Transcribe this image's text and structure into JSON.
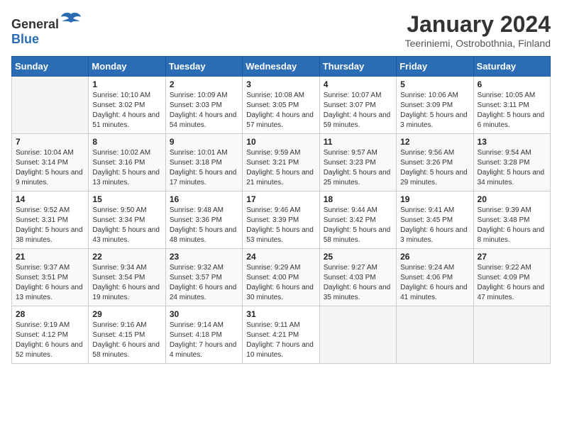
{
  "logo": {
    "general": "General",
    "blue": "Blue"
  },
  "header": {
    "title": "January 2024",
    "subtitle": "Teeriniemi, Ostrobothnia, Finland"
  },
  "weekdays": [
    "Sunday",
    "Monday",
    "Tuesday",
    "Wednesday",
    "Thursday",
    "Friday",
    "Saturday"
  ],
  "weeks": [
    [
      {
        "day": "",
        "sunrise": "",
        "sunset": "",
        "daylight": ""
      },
      {
        "day": "1",
        "sunrise": "Sunrise: 10:10 AM",
        "sunset": "Sunset: 3:02 PM",
        "daylight": "Daylight: 4 hours and 51 minutes."
      },
      {
        "day": "2",
        "sunrise": "Sunrise: 10:09 AM",
        "sunset": "Sunset: 3:03 PM",
        "daylight": "Daylight: 4 hours and 54 minutes."
      },
      {
        "day": "3",
        "sunrise": "Sunrise: 10:08 AM",
        "sunset": "Sunset: 3:05 PM",
        "daylight": "Daylight: 4 hours and 57 minutes."
      },
      {
        "day": "4",
        "sunrise": "Sunrise: 10:07 AM",
        "sunset": "Sunset: 3:07 PM",
        "daylight": "Daylight: 4 hours and 59 minutes."
      },
      {
        "day": "5",
        "sunrise": "Sunrise: 10:06 AM",
        "sunset": "Sunset: 3:09 PM",
        "daylight": "Daylight: 5 hours and 3 minutes."
      },
      {
        "day": "6",
        "sunrise": "Sunrise: 10:05 AM",
        "sunset": "Sunset: 3:11 PM",
        "daylight": "Daylight: 5 hours and 6 minutes."
      }
    ],
    [
      {
        "day": "7",
        "sunrise": "Sunrise: 10:04 AM",
        "sunset": "Sunset: 3:14 PM",
        "daylight": "Daylight: 5 hours and 9 minutes."
      },
      {
        "day": "8",
        "sunrise": "Sunrise: 10:02 AM",
        "sunset": "Sunset: 3:16 PM",
        "daylight": "Daylight: 5 hours and 13 minutes."
      },
      {
        "day": "9",
        "sunrise": "Sunrise: 10:01 AM",
        "sunset": "Sunset: 3:18 PM",
        "daylight": "Daylight: 5 hours and 17 minutes."
      },
      {
        "day": "10",
        "sunrise": "Sunrise: 9:59 AM",
        "sunset": "Sunset: 3:21 PM",
        "daylight": "Daylight: 5 hours and 21 minutes."
      },
      {
        "day": "11",
        "sunrise": "Sunrise: 9:57 AM",
        "sunset": "Sunset: 3:23 PM",
        "daylight": "Daylight: 5 hours and 25 minutes."
      },
      {
        "day": "12",
        "sunrise": "Sunrise: 9:56 AM",
        "sunset": "Sunset: 3:26 PM",
        "daylight": "Daylight: 5 hours and 29 minutes."
      },
      {
        "day": "13",
        "sunrise": "Sunrise: 9:54 AM",
        "sunset": "Sunset: 3:28 PM",
        "daylight": "Daylight: 5 hours and 34 minutes."
      }
    ],
    [
      {
        "day": "14",
        "sunrise": "Sunrise: 9:52 AM",
        "sunset": "Sunset: 3:31 PM",
        "daylight": "Daylight: 5 hours and 38 minutes."
      },
      {
        "day": "15",
        "sunrise": "Sunrise: 9:50 AM",
        "sunset": "Sunset: 3:34 PM",
        "daylight": "Daylight: 5 hours and 43 minutes."
      },
      {
        "day": "16",
        "sunrise": "Sunrise: 9:48 AM",
        "sunset": "Sunset: 3:36 PM",
        "daylight": "Daylight: 5 hours and 48 minutes."
      },
      {
        "day": "17",
        "sunrise": "Sunrise: 9:46 AM",
        "sunset": "Sunset: 3:39 PM",
        "daylight": "Daylight: 5 hours and 53 minutes."
      },
      {
        "day": "18",
        "sunrise": "Sunrise: 9:44 AM",
        "sunset": "Sunset: 3:42 PM",
        "daylight": "Daylight: 5 hours and 58 minutes."
      },
      {
        "day": "19",
        "sunrise": "Sunrise: 9:41 AM",
        "sunset": "Sunset: 3:45 PM",
        "daylight": "Daylight: 6 hours and 3 minutes."
      },
      {
        "day": "20",
        "sunrise": "Sunrise: 9:39 AM",
        "sunset": "Sunset: 3:48 PM",
        "daylight": "Daylight: 6 hours and 8 minutes."
      }
    ],
    [
      {
        "day": "21",
        "sunrise": "Sunrise: 9:37 AM",
        "sunset": "Sunset: 3:51 PM",
        "daylight": "Daylight: 6 hours and 13 minutes."
      },
      {
        "day": "22",
        "sunrise": "Sunrise: 9:34 AM",
        "sunset": "Sunset: 3:54 PM",
        "daylight": "Daylight: 6 hours and 19 minutes."
      },
      {
        "day": "23",
        "sunrise": "Sunrise: 9:32 AM",
        "sunset": "Sunset: 3:57 PM",
        "daylight": "Daylight: 6 hours and 24 minutes."
      },
      {
        "day": "24",
        "sunrise": "Sunrise: 9:29 AM",
        "sunset": "Sunset: 4:00 PM",
        "daylight": "Daylight: 6 hours and 30 minutes."
      },
      {
        "day": "25",
        "sunrise": "Sunrise: 9:27 AM",
        "sunset": "Sunset: 4:03 PM",
        "daylight": "Daylight: 6 hours and 35 minutes."
      },
      {
        "day": "26",
        "sunrise": "Sunrise: 9:24 AM",
        "sunset": "Sunset: 4:06 PM",
        "daylight": "Daylight: 6 hours and 41 minutes."
      },
      {
        "day": "27",
        "sunrise": "Sunrise: 9:22 AM",
        "sunset": "Sunset: 4:09 PM",
        "daylight": "Daylight: 6 hours and 47 minutes."
      }
    ],
    [
      {
        "day": "28",
        "sunrise": "Sunrise: 9:19 AM",
        "sunset": "Sunset: 4:12 PM",
        "daylight": "Daylight: 6 hours and 52 minutes."
      },
      {
        "day": "29",
        "sunrise": "Sunrise: 9:16 AM",
        "sunset": "Sunset: 4:15 PM",
        "daylight": "Daylight: 6 hours and 58 minutes."
      },
      {
        "day": "30",
        "sunrise": "Sunrise: 9:14 AM",
        "sunset": "Sunset: 4:18 PM",
        "daylight": "Daylight: 7 hours and 4 minutes."
      },
      {
        "day": "31",
        "sunrise": "Sunrise: 9:11 AM",
        "sunset": "Sunset: 4:21 PM",
        "daylight": "Daylight: 7 hours and 10 minutes."
      },
      {
        "day": "",
        "sunrise": "",
        "sunset": "",
        "daylight": ""
      },
      {
        "day": "",
        "sunrise": "",
        "sunset": "",
        "daylight": ""
      },
      {
        "day": "",
        "sunrise": "",
        "sunset": "",
        "daylight": ""
      }
    ]
  ]
}
